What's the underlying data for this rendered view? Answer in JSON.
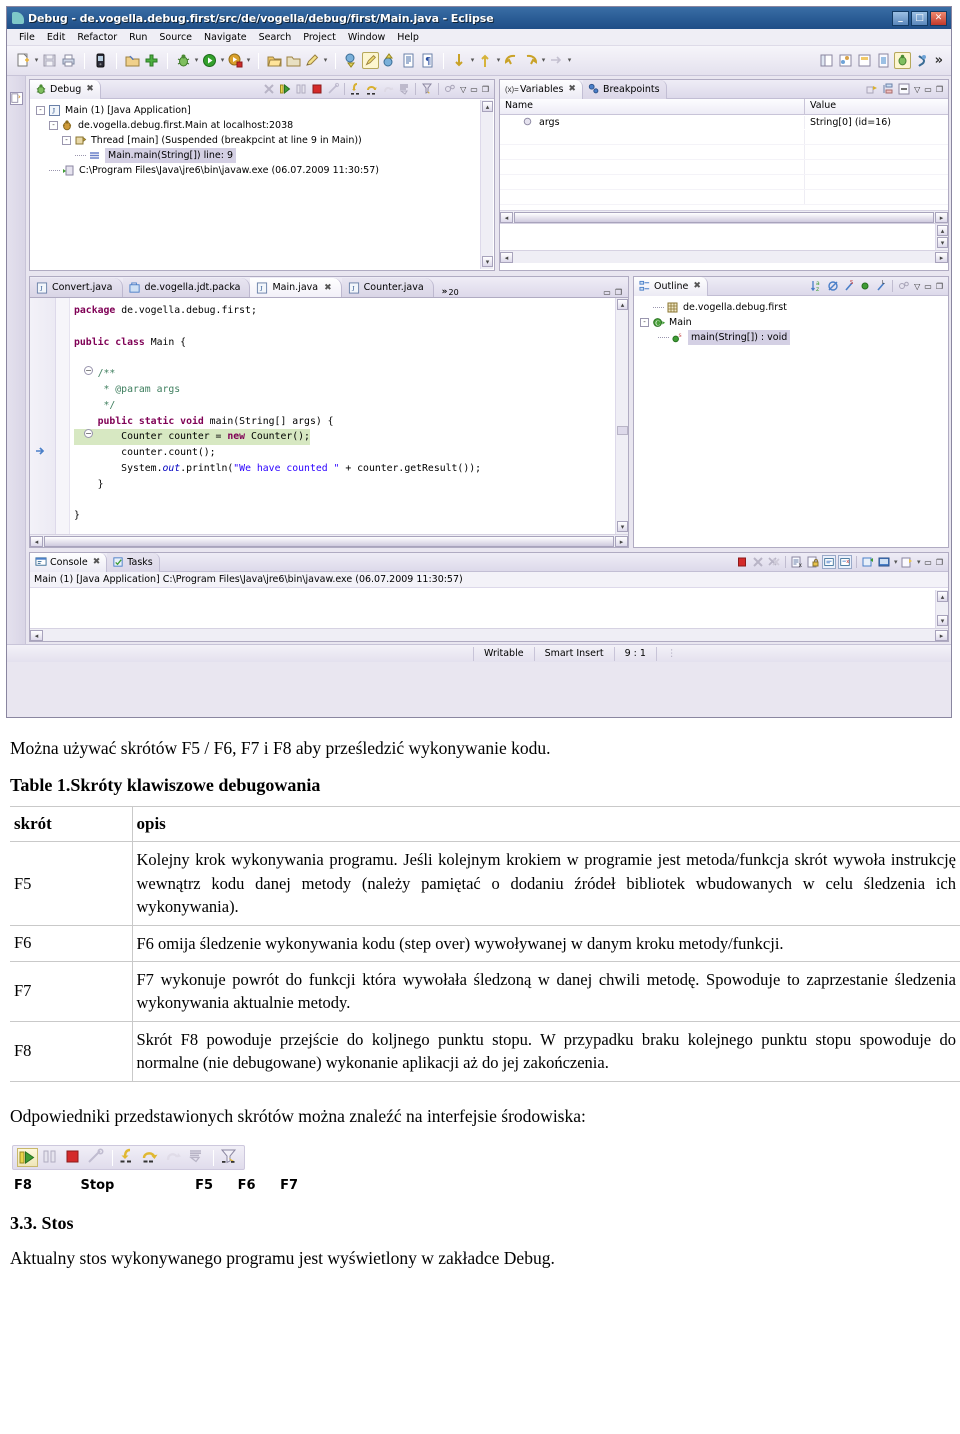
{
  "eclipse": {
    "window_title": "Debug - de.vogella.debug.first/src/de/vogella/debug/first/Main.java - Eclipse",
    "window_buttons": {
      "minimize": "_",
      "maximize": "□",
      "close": "✕"
    },
    "menu": [
      "File",
      "Edit",
      "Refactor",
      "Run",
      "Source",
      "Navigate",
      "Search",
      "Project",
      "Window",
      "Help"
    ],
    "toolbar_overflow": "»",
    "debug_view": {
      "tab_label": "Debug",
      "tab_close": "✖",
      "tree": [
        {
          "indent": 0,
          "expander": "-",
          "icon": "java-app-icon",
          "label": "Main (1) [Java Application]"
        },
        {
          "indent": 1,
          "expander": "-",
          "icon": "debug-target-icon",
          "label": "de.vogella.debug.first.Main at localhost:2038"
        },
        {
          "indent": 2,
          "expander": "-",
          "icon": "thread-icon",
          "label": "Thread [main] (Suspended (breakpcint at line 9 in Main))"
        },
        {
          "indent": 3,
          "expander": "",
          "icon": "stack-frame-icon",
          "label": "Main.main(String[]) line: 9",
          "selected": true
        },
        {
          "indent": 1,
          "expander": "",
          "icon": "process-icon",
          "label": "C:\\Program Files\\Java\\jre6\\bin\\javaw.exe (06.07.2009 11:30:57)"
        }
      ]
    },
    "variables_view": {
      "tabs": [
        {
          "label": "Variables",
          "icon": "variables-icon",
          "active": true,
          "close": "✖"
        },
        {
          "label": "Breakpoints",
          "icon": "breakpoints-icon",
          "active": false
        }
      ],
      "columns": [
        "Name",
        "Value"
      ],
      "rows": [
        {
          "name": "args",
          "value": "String[0]  (id=16)",
          "icon": "local-variable-icon"
        }
      ]
    },
    "editor": {
      "tabs": [
        {
          "label": "Convert.java",
          "icon": "java-file-icon",
          "active": false
        },
        {
          "label": "de.vogella.jdt.packa",
          "icon": "package-file-icon",
          "active": false
        },
        {
          "label": "Main.java",
          "icon": "java-file-icon",
          "active": true,
          "close": "✖"
        },
        {
          "label": "Counter.java",
          "icon": "java-file-icon",
          "active": false
        }
      ],
      "more_tabs_chevron": "»",
      "more_tabs_count": "20",
      "code_lines": [
        {
          "tokens": [
            {
              "t": "package ",
              "c": "kw"
            },
            {
              "t": "de.vogella.debug.first;",
              "c": ""
            }
          ]
        },
        {
          "tokens": []
        },
        {
          "tokens": [
            {
              "t": "public class ",
              "c": "kw"
            },
            {
              "t": "Main {",
              "c": ""
            }
          ]
        },
        {
          "tokens": []
        },
        {
          "tokens": [
            {
              "t": "    /**",
              "c": "cmt"
            }
          ]
        },
        {
          "tokens": [
            {
              "t": "     * @param args",
              "c": "cmt"
            }
          ]
        },
        {
          "tokens": [
            {
              "t": "     */",
              "c": "cmt"
            }
          ]
        },
        {
          "tokens": [
            {
              "t": "    public static void ",
              "c": "kw"
            },
            {
              "t": "main(String[] args) {",
              "c": ""
            }
          ]
        },
        {
          "highlight": true,
          "tokens": [
            {
              "t": "        Counter counter = ",
              "c": ""
            },
            {
              "t": "new ",
              "c": "kw"
            },
            {
              "t": "Counter();",
              "c": ""
            }
          ]
        },
        {
          "tokens": [
            {
              "t": "        counter.count();",
              "c": ""
            }
          ]
        },
        {
          "tokens": [
            {
              "t": "        System.",
              "c": ""
            },
            {
              "t": "out",
              "c": "ital"
            },
            {
              "t": ".println(",
              "c": ""
            },
            {
              "t": "\"We have counted \"",
              "c": "str"
            },
            {
              "t": " + counter.getResult());",
              "c": ""
            }
          ]
        },
        {
          "tokens": [
            {
              "t": "    }",
              "c": ""
            }
          ]
        },
        {
          "tokens": []
        },
        {
          "tokens": [
            {
              "t": "}",
              "c": ""
            }
          ]
        }
      ]
    },
    "outline_view": {
      "tab_label": "Outline",
      "tab_close": "✖",
      "tree": [
        {
          "indent": 0,
          "expander": "",
          "icon": "package-icon",
          "label": "de.vogella.debug.first"
        },
        {
          "indent": 0,
          "expander": "-",
          "icon": "class-icon",
          "label": "Main"
        },
        {
          "indent": 1,
          "expander": "",
          "icon": "method-icon",
          "label": "main(String[]) : void",
          "selected": true
        }
      ]
    },
    "console_view": {
      "tabs": [
        {
          "label": "Console",
          "icon": "console-icon",
          "active": true,
          "close": "✖"
        },
        {
          "label": "Tasks",
          "icon": "tasks-icon",
          "active": false
        }
      ],
      "command_line": "Main (1) [Java Application] C:\\Program Files\\Java\\jre6\\bin\\javaw.exe (06.07.2009 11:30:57)"
    },
    "status_bar": {
      "writable": "Writable",
      "insert_mode": "Smart Insert",
      "position": "9 : 1"
    }
  },
  "document": {
    "intro": "Można używać skrótów F5 / F6, F7 i F8 aby prześledzić wykonywanie kodu.",
    "table_caption": "Table 1.Skróty klawiszowe debugowania",
    "table": {
      "headers": [
        "skrót",
        "opis"
      ],
      "rows": [
        {
          "key": "F5",
          "desc": "Kolejny krok wykonywania programu. Jeśli kolejnym krokiem w programie jest metoda/funkcja skrót wywoła instrukcję wewnątrz kodu danej metody (należy pamiętać o dodaniu źródeł bibliotek wbudowanych w celu śledzenia ich wykonywania)."
        },
        {
          "key": "F6",
          "desc": "F6 omija śledzenie wykonywania kodu (step over)  wywoływanej w danym kroku metody/funkcji."
        },
        {
          "key": "F7",
          "desc": "F7 wykonuje powrót do funkcji która wywołała śledzoną w danej chwili metodę. Spowoduje to zaprzestanie śledzenia wykonywania aktualnie metody."
        },
        {
          "key": "F8",
          "desc": "Skrót F8 powoduje przejście do koljnego punktu stopu. W przypadku braku kolejnego punktu stopu spowoduje do normalne (nie debugowane) wykonanie aplikacji aż do jej zakończenia."
        }
      ]
    },
    "figure_intro": "Odpowiedniki przedstawionych skrótów można znaleźć na interfejsie środowiska:",
    "figure_labels": {
      "resume": "F8",
      "terminate": "Stop",
      "step_into": "F5",
      "step_over": "F6",
      "step_return": "F7"
    },
    "section_heading": "3.3. Stos",
    "section_text": "Aktualny stos wykonywanego programu jest wyświetlony w zakładce Debug."
  }
}
